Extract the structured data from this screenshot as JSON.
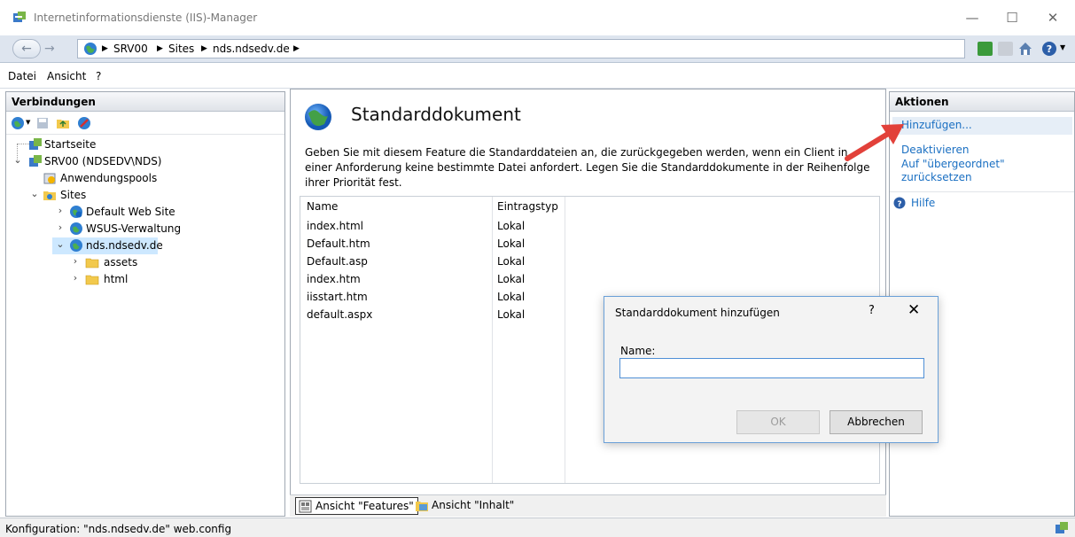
{
  "window": {
    "title": "Internetinformationsdienste (IIS)-Manager"
  },
  "addressbar": {
    "crumbs": [
      "SRV00",
      "Sites",
      "nds.ndsedv.de"
    ]
  },
  "menu": {
    "items": [
      "Datei",
      "Ansicht",
      "?"
    ]
  },
  "connections": {
    "header": "Verbindungen",
    "tree": [
      {
        "label": "Startseite"
      },
      {
        "label": "SRV00 (NDSEDV\\NDS)"
      },
      {
        "label": "Anwendungspools"
      },
      {
        "label": "Sites"
      },
      {
        "label": "Default Web Site"
      },
      {
        "label": "WSUS-Verwaltung"
      },
      {
        "label": "nds.ndsedv.de"
      },
      {
        "label": "assets"
      },
      {
        "label": "html"
      }
    ]
  },
  "center": {
    "title": "Standarddokument",
    "description": "Geben Sie mit diesem Feature die Standarddateien an, die zurückgegeben werden, wenn ein Client in einer Anforderung keine bestimmte Datei anfordert. Legen Sie die Standarddokumente in der Reihenfolge ihrer Priorität fest.",
    "columns": [
      "Name",
      "Eintragstyp"
    ],
    "rows": [
      {
        "name": "index.html",
        "type": "Lokal"
      },
      {
        "name": "Default.htm",
        "type": "Lokal"
      },
      {
        "name": "Default.asp",
        "type": "Lokal"
      },
      {
        "name": "index.htm",
        "type": "Lokal"
      },
      {
        "name": "iisstart.htm",
        "type": "Lokal"
      },
      {
        "name": "default.aspx",
        "type": "Lokal"
      }
    ],
    "view_tabs": [
      "Ansicht \"Features\"",
      "Ansicht \"Inhalt\""
    ]
  },
  "actions": {
    "header": "Aktionen",
    "add": "Hinzufügen...",
    "disable": "Deaktivieren",
    "reset_line1": "Auf \"übergeordnet\"",
    "reset_line2": "zurücksetzen",
    "help": "Hilfe"
  },
  "statusbar": {
    "text": "Konfiguration: \"nds.ndsedv.de\" web.config"
  },
  "dialog": {
    "title": "Standarddokument hinzufügen",
    "help_glyph": "?",
    "close_glyph": "✕",
    "name_label": "Name:",
    "name_value": "",
    "ok_label": "OK",
    "cancel_label": "Abbrechen"
  },
  "colors": {
    "link": "#1a6fc2",
    "selection": "#cde8ff",
    "dialog_border": "#6aa0d8",
    "arrow": "#e2413a"
  }
}
